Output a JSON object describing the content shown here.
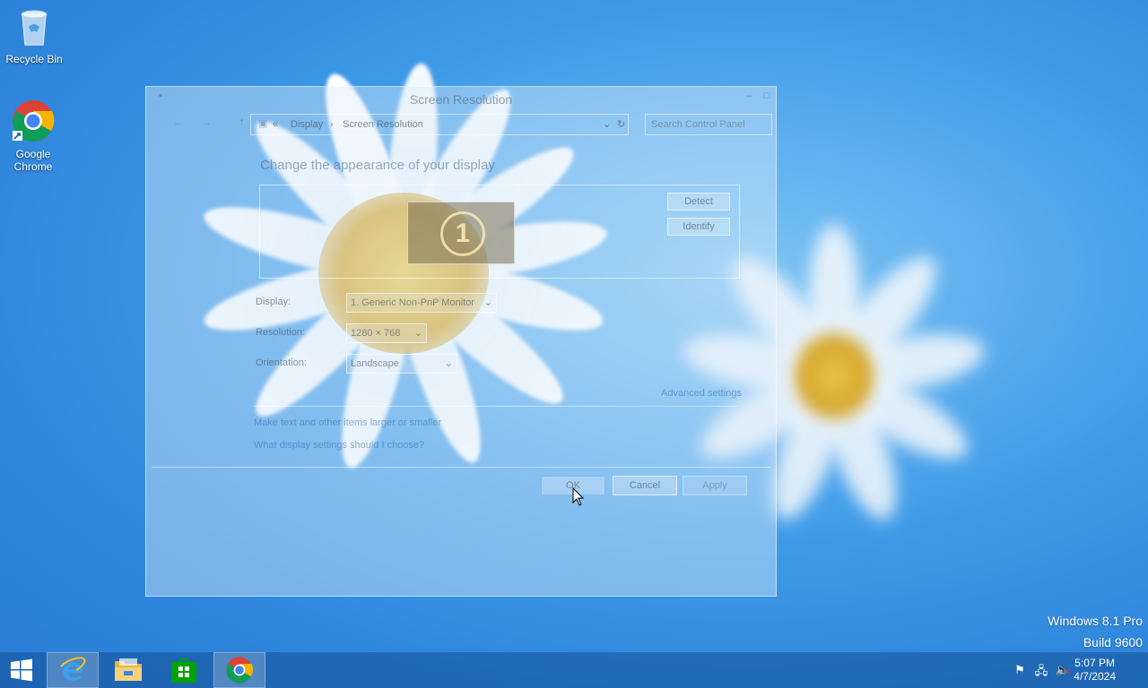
{
  "desktop": {
    "icons": [
      {
        "label": "Recycle Bin",
        "icon": "recycle-bin-icon"
      },
      {
        "label": "Google Chrome",
        "icon": "chrome-icon"
      }
    ],
    "watermark": {
      "line1": "Windows 8.1 Pro",
      "line2": "Build 9600"
    }
  },
  "window": {
    "title": "Screen Resolution",
    "breadcrumb": [
      "Display",
      "Screen Resolution"
    ],
    "breadcrumb_prefix": "«",
    "breadcrumb_sep": "›",
    "search_placeholder": "Search Control Panel",
    "heading": "Change the appearance of your display",
    "monitor_number": "1",
    "detect_label": "Detect",
    "identify_label": "Identify",
    "display_label": "Display:",
    "display_value": "1. Generic Non-PnP Monitor",
    "resolution_label": "Resolution:",
    "resolution_value": "1280 × 768",
    "orientation_label": "Orientation:",
    "orientation_value": "Landscape",
    "advanced_link": "Advanced settings",
    "link_text_larger": "Make text and other items larger or smaller",
    "link_choose": "What display settings should I choose?",
    "ok_label": "OK",
    "cancel_label": "Cancel",
    "apply_label": "Apply"
  },
  "taskbar": {
    "items": [
      "start-icon",
      "internet-explorer-icon",
      "file-explorer-icon",
      "store-icon",
      "chrome-icon"
    ],
    "time": "5:07 PM",
    "date": "4/7/2024"
  },
  "colors": {
    "desktop": "#3f9be8",
    "taskbar": "#1e5aa0"
  }
}
